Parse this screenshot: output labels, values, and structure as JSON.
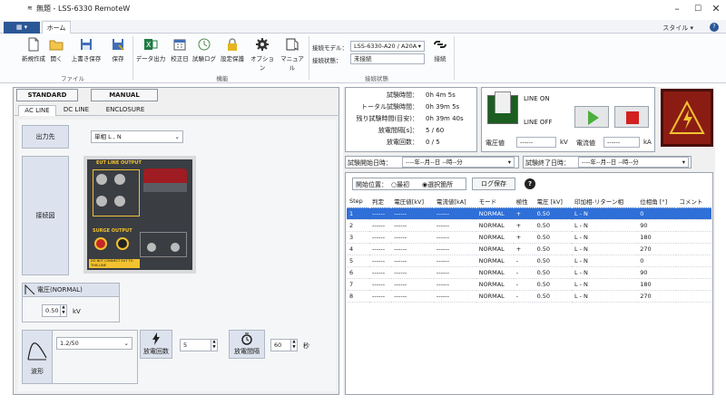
{
  "window": {
    "title": "無題 - LSS-6330 RemoteW",
    "minimize": "–",
    "maximize": "☐",
    "close": "✕"
  },
  "ribbon_tabs": {
    "file": "▾",
    "home": "ホーム",
    "style_label": "スタイル",
    "style_arrow": "▾",
    "help_icon": "?"
  },
  "ribbon": {
    "buttons": [
      {
        "label": "新規作成",
        "icon": "new-file-icon"
      },
      {
        "label": "開く",
        "icon": "open-folder-icon"
      },
      {
        "label": "上書き保存",
        "icon": "save-icon"
      },
      {
        "label": "保存",
        "icon": "save-as-icon"
      },
      {
        "label": "データ出力",
        "icon": "excel-icon"
      },
      {
        "label": "校正日",
        "icon": "calendar-icon"
      },
      {
        "label": "試験ログ",
        "icon": "log-icon"
      },
      {
        "label": "設定保護",
        "icon": "lock-icon"
      },
      {
        "label": "オプション",
        "icon": "gear-icon"
      },
      {
        "label": "マニュアル",
        "icon": "manual-icon"
      }
    ],
    "groups": {
      "file": "ファイル",
      "function": "機能",
      "connection": "接続状態"
    },
    "connection": {
      "model_label": "接続モデル：",
      "model_value": "LSS-6330-A20 / A20A",
      "status_label": "接続状態：",
      "status_value": "未接続",
      "connect_label": "接続"
    }
  },
  "left": {
    "tabs": {
      "standard": "STANDARD",
      "manual": "MANUAL"
    },
    "subtabs": [
      "AC LINE",
      "DC LINE",
      "ENCLOSURE"
    ],
    "output_label": "出力先",
    "output_value": "単相 L , N",
    "connection_label": "接続図",
    "diagram": {
      "eut_title": "EUT LINE OUTPUT",
      "surge_title": "SURGE OUTPUT",
      "notice": "DO NOT CONNECT EUT TO THIS LINE"
    },
    "voltage_label": "電圧(NORMAL)",
    "voltage_value": "0.50",
    "voltage_unit": "kV",
    "waveform_label": "波形",
    "waveform_value": "1.2/50",
    "discharge_count_label": "放電回数",
    "discharge_count_value": "5",
    "discharge_interval_label": "放電間隔",
    "discharge_interval_value": "60",
    "discharge_interval_unit": "秒"
  },
  "status": {
    "rows": [
      {
        "label": "試験時間：",
        "value": "0h  4m  5s"
      },
      {
        "label": "トータル試験時間：",
        "value": "0h 39m  5s"
      },
      {
        "label": "残り試験時間(目安)：",
        "value": "0h 39m 40s"
      },
      {
        "label": "放電間隔[s]：",
        "value": "5 /  60"
      },
      {
        "label": "放電回数：",
        "value": "0  /   5"
      }
    ],
    "line_on": "LINE ON",
    "line_off": "LINE OFF",
    "voltage_label": "電圧値",
    "voltage_value": "------",
    "voltage_unit": "kV",
    "current_label": "電流値",
    "current_value": "------",
    "current_unit": "kA"
  },
  "dates": {
    "start_label": "試験開始日時：",
    "start_value": "----年--月--日 --時--分",
    "end_label": "試験終了日時：",
    "end_value": "----年--月--日 --時--分"
  },
  "results": {
    "start_position_label": "開始位置：",
    "radio_first": "最初",
    "radio_selected": "選択箇所",
    "log_save_button": "ログ保存",
    "help_icon": "?",
    "columns": [
      "Step",
      "判定",
      "電圧値[kV]",
      "電流値[kA]",
      "モード",
      "極性",
      "電圧 [kV]",
      "印加相-リターン相",
      "位相角 [°]",
      "コメント"
    ],
    "rows": [
      [
        "1",
        "------",
        "------",
        "------",
        "NORMAL",
        "+",
        "0.50",
        "L - N",
        "0",
        ""
      ],
      [
        "2",
        "------",
        "------",
        "------",
        "NORMAL",
        "+",
        "0.50",
        "L - N",
        "90",
        ""
      ],
      [
        "3",
        "------",
        "------",
        "------",
        "NORMAL",
        "+",
        "0.50",
        "L - N",
        "180",
        ""
      ],
      [
        "4",
        "------",
        "------",
        "------",
        "NORMAL",
        "+",
        "0.50",
        "L - N",
        "270",
        ""
      ],
      [
        "5",
        "------",
        "------",
        "------",
        "NORMAL",
        "-",
        "0.50",
        "L - N",
        "0",
        ""
      ],
      [
        "6",
        "------",
        "------",
        "------",
        "NORMAL",
        "-",
        "0.50",
        "L - N",
        "90",
        ""
      ],
      [
        "7",
        "------",
        "------",
        "------",
        "NORMAL",
        "-",
        "0.50",
        "L - N",
        "180",
        ""
      ],
      [
        "8",
        "------",
        "------",
        "------",
        "NORMAL",
        "-",
        "0.50",
        "L - N",
        "270",
        ""
      ]
    ]
  }
}
